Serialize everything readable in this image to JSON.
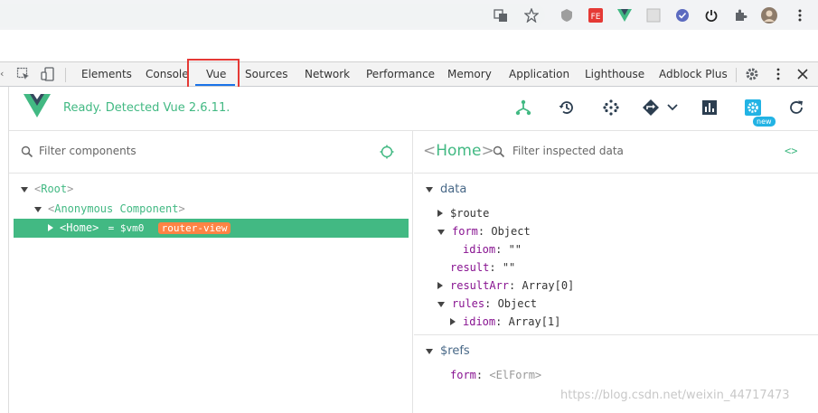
{
  "devtools": {
    "tabs": [
      "Elements",
      "Console",
      "Vue",
      "Sources",
      "Network",
      "Performance",
      "Memory",
      "Application",
      "Lighthouse",
      "Adblock Plus"
    ],
    "active_tab": "Vue"
  },
  "vue_header": {
    "status": "Ready. Detected Vue 2.6.11.",
    "new_badge": "new"
  },
  "components": {
    "filter_placeholder": "Filter components",
    "tree": [
      {
        "tag": "Root",
        "expanded": true
      },
      {
        "tag": "Anonymous Component",
        "expanded": true
      },
      {
        "tag": "Home",
        "ref": "= $vm0",
        "badge": "router-view",
        "selected": true
      }
    ]
  },
  "inspector": {
    "component": "Home",
    "filter_placeholder": "Filter inspected data",
    "data_section": "data",
    "props": [
      {
        "key": "$route",
        "value": ""
      },
      {
        "key": "form",
        "value": "Object"
      },
      {
        "key": "idiom",
        "value": "\"\""
      },
      {
        "key": "result",
        "value": "\"\""
      },
      {
        "key": "resultArr",
        "value": "Array[0]"
      },
      {
        "key": "rules",
        "value": "Object"
      },
      {
        "key": "idiom",
        "value": "Array[1]"
      }
    ],
    "refs_section": "$refs",
    "refs": [
      {
        "key": "form",
        "value": "<ElForm>"
      }
    ]
  },
  "watermark": "https://blog.csdn.net/weixin_44717473",
  "colors": {
    "vue_green": "#42b983",
    "router_badge": "#ff8344",
    "highlight_red": "#e53935",
    "tab_blue": "#1a73e8"
  }
}
